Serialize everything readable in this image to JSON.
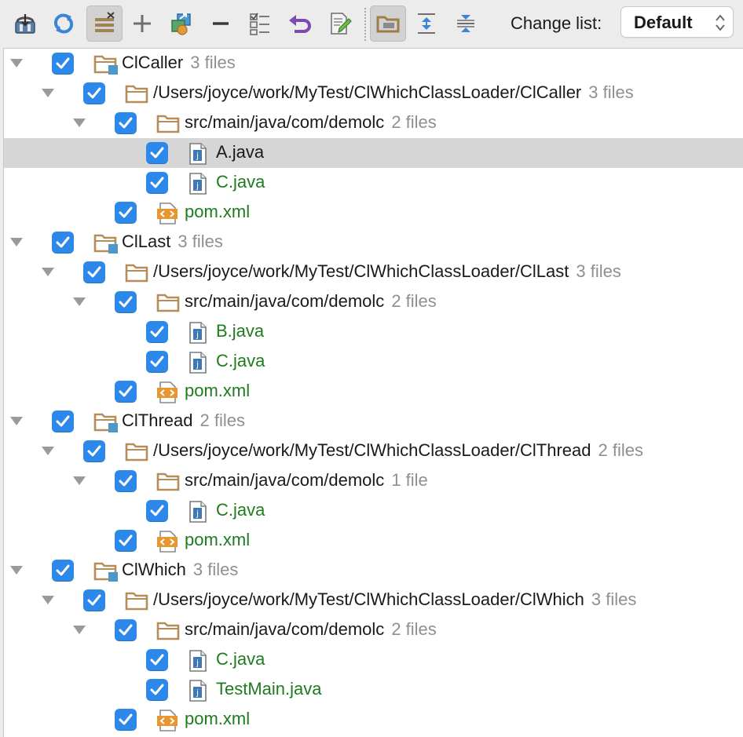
{
  "toolbar": {
    "buttons": [
      {
        "name": "commit-icon"
      },
      {
        "name": "refresh-icon"
      },
      {
        "name": "group-by-directory-icon"
      },
      {
        "name": "add-icon"
      },
      {
        "name": "move-to-changelist-icon"
      },
      {
        "name": "remove-icon"
      },
      {
        "name": "show-diff-icon"
      },
      {
        "name": "rollback-icon"
      },
      {
        "name": "edit-source-icon"
      },
      {
        "name": "show-directories-icon"
      },
      {
        "name": "expand-all-icon"
      },
      {
        "name": "collapse-all-icon"
      }
    ],
    "change_list_label": "Change list:",
    "change_list_value": "Default"
  },
  "tree": [
    {
      "level": 0,
      "type": "module",
      "label": "ClCaller",
      "count": "3 files",
      "green": false
    },
    {
      "level": 1,
      "type": "folder",
      "label": "/Users/joyce/work/MyTest/ClWhichClassLoader/ClCaller",
      "count": "3 files",
      "green": false
    },
    {
      "level": 2,
      "type": "folder",
      "label": "src/main/java/com/demolc",
      "count": "2 files",
      "green": false
    },
    {
      "level": 3,
      "type": "java",
      "label": "A.java",
      "count": "",
      "green": false,
      "selected": true
    },
    {
      "level": 3,
      "type": "java",
      "label": "C.java",
      "count": "",
      "green": true
    },
    {
      "level": 2,
      "type": "xml",
      "label": "pom.xml",
      "count": "",
      "green": true
    },
    {
      "level": 0,
      "type": "module",
      "label": "ClLast",
      "count": "3 files",
      "green": false
    },
    {
      "level": 1,
      "type": "folder",
      "label": "/Users/joyce/work/MyTest/ClWhichClassLoader/ClLast",
      "count": "3 files",
      "green": false
    },
    {
      "level": 2,
      "type": "folder",
      "label": "src/main/java/com/demolc",
      "count": "2 files",
      "green": false
    },
    {
      "level": 3,
      "type": "java",
      "label": "B.java",
      "count": "",
      "green": true
    },
    {
      "level": 3,
      "type": "java",
      "label": "C.java",
      "count": "",
      "green": true
    },
    {
      "level": 2,
      "type": "xml",
      "label": "pom.xml",
      "count": "",
      "green": true
    },
    {
      "level": 0,
      "type": "module",
      "label": "ClThread",
      "count": "2 files",
      "green": false
    },
    {
      "level": 1,
      "type": "folder",
      "label": "/Users/joyce/work/MyTest/ClWhichClassLoader/ClThread",
      "count": "2 files",
      "green": false
    },
    {
      "level": 2,
      "type": "folder",
      "label": "src/main/java/com/demolc",
      "count": "1 file",
      "green": false
    },
    {
      "level": 3,
      "type": "java",
      "label": "C.java",
      "count": "",
      "green": true
    },
    {
      "level": 2,
      "type": "xml",
      "label": "pom.xml",
      "count": "",
      "green": true
    },
    {
      "level": 0,
      "type": "module",
      "label": "ClWhich",
      "count": "3 files",
      "green": false
    },
    {
      "level": 1,
      "type": "folder",
      "label": "/Users/joyce/work/MyTest/ClWhichClassLoader/ClWhich",
      "count": "3 files",
      "green": false
    },
    {
      "level": 2,
      "type": "folder",
      "label": "src/main/java/com/demolc",
      "count": "2 files",
      "green": false
    },
    {
      "level": 3,
      "type": "java",
      "label": "C.java",
      "count": "",
      "green": true
    },
    {
      "level": 3,
      "type": "java",
      "label": "TestMain.java",
      "count": "",
      "green": true
    },
    {
      "level": 2,
      "type": "xml",
      "label": "pom.xml",
      "count": "",
      "green": true
    }
  ],
  "colors": {
    "checkbox": "#2c88ea",
    "folder": "#b58d5a",
    "added_file_text": "#1e7b1e",
    "selection": "#d6d6d6",
    "count_text": "#8f8f8f"
  }
}
